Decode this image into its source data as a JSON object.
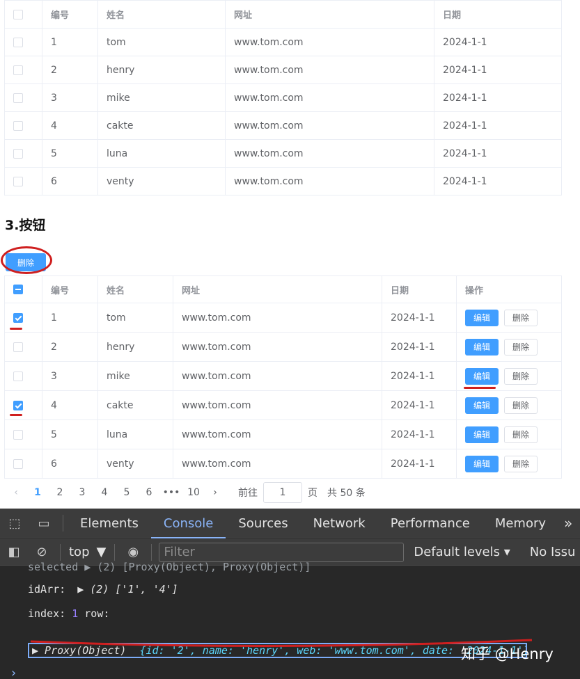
{
  "table1": {
    "headers": [
      "编号",
      "姓名",
      "网址",
      "日期"
    ],
    "rows": [
      [
        "1",
        "tom",
        "www.tom.com",
        "2024-1-1"
      ],
      [
        "2",
        "henry",
        "www.tom.com",
        "2024-1-1"
      ],
      [
        "3",
        "mike",
        "www.tom.com",
        "2024-1-1"
      ],
      [
        "4",
        "cakte",
        "www.tom.com",
        "2024-1-1"
      ],
      [
        "5",
        "luna",
        "www.tom.com",
        "2024-1-1"
      ],
      [
        "6",
        "venty",
        "www.tom.com",
        "2024-1-1"
      ]
    ]
  },
  "section": {
    "title": "3.按钮",
    "delete_label": "删除"
  },
  "table2": {
    "headers": [
      "编号",
      "姓名",
      "网址",
      "日期",
      "操作"
    ],
    "edit_label": "编辑",
    "delete_label": "删除",
    "rows": [
      {
        "id": "1",
        "name": "tom",
        "web": "www.tom.com",
        "date": "2024-1-1",
        "checked": true
      },
      {
        "id": "2",
        "name": "henry",
        "web": "www.tom.com",
        "date": "2024-1-1",
        "checked": false
      },
      {
        "id": "3",
        "name": "mike",
        "web": "www.tom.com",
        "date": "2024-1-1",
        "checked": false
      },
      {
        "id": "4",
        "name": "cakte",
        "web": "www.tom.com",
        "date": "2024-1-1",
        "checked": true
      },
      {
        "id": "5",
        "name": "luna",
        "web": "www.tom.com",
        "date": "2024-1-1",
        "checked": false
      },
      {
        "id": "6",
        "name": "venty",
        "web": "www.tom.com",
        "date": "2024-1-1",
        "checked": false
      }
    ]
  },
  "pagination": {
    "prev": "‹",
    "pages": [
      "1",
      "2",
      "3",
      "4",
      "5",
      "6",
      "•••",
      "10"
    ],
    "next": "›",
    "goto_prefix": "前往",
    "goto_value": "1",
    "goto_suffix": "页",
    "total": "共 50 条"
  },
  "devtools": {
    "tabs": [
      "Elements",
      "Console",
      "Sources",
      "Network",
      "Performance",
      "Memory"
    ],
    "active_tab": "Console",
    "more": "»",
    "context": "top",
    "filter_placeholder": "Filter",
    "levels": "Default levels ▾",
    "issues": "No Issu",
    "console": {
      "line0": "selected ▶ (2) [Proxy(Object), Proxy(Object)]",
      "idarr_label": "idArr:",
      "idarr_value": "▶ (2) ['1', '4']",
      "index_label": "index:",
      "index_value": "1",
      "row_label": "row:",
      "proxy_prefix": "▶ Proxy(Object)",
      "proxy_body": "{id: '2', name: 'henry', web: 'www.tom.com', date: '2024-1-1'}",
      "prompt": "›"
    },
    "watermark": "知乎 @Henry"
  },
  "colors": {
    "primary": "#409eff",
    "annotation_red": "#cf1f1f",
    "devtools_bg": "#282828"
  }
}
